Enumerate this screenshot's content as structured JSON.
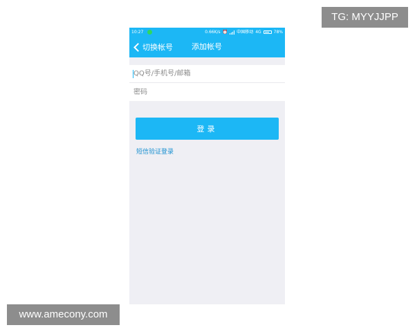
{
  "watermarks": {
    "tg": "TG: MYYJJPP",
    "site": "www.amecony.com"
  },
  "status_bar": {
    "time": "10:27",
    "network_speed": "0.66K/s",
    "carrier": "中国移动",
    "network_type": "4G",
    "battery": "78%"
  },
  "title_bar": {
    "back_label": "切换帐号",
    "title": "添加帐号"
  },
  "form": {
    "account": {
      "value": "",
      "placeholder": "QQ号/手机号/邮箱"
    },
    "password": {
      "value": "",
      "placeholder": "密码"
    }
  },
  "login_button": "登录",
  "sms_login_link": "短信验证登录",
  "colors": {
    "accent": "#1cb7f5",
    "link": "#1a90d0",
    "background": "#efeff4"
  }
}
